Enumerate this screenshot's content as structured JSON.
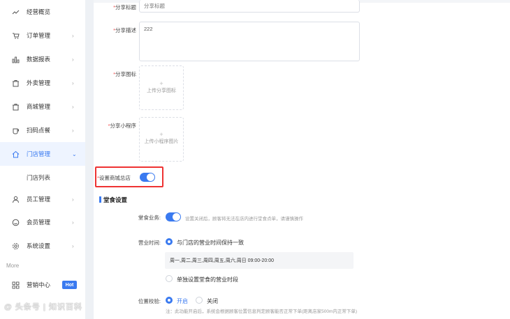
{
  "sidebar": {
    "items": [
      {
        "label": "经营概览",
        "icon": "trend-icon",
        "chev": ""
      },
      {
        "label": "订单管理",
        "icon": "cart-icon",
        "chev": "›"
      },
      {
        "label": "数据报表",
        "icon": "bar-chart-icon",
        "chev": "›"
      },
      {
        "label": "外卖管理",
        "icon": "takeout-icon",
        "chev": "›"
      },
      {
        "label": "商城管理",
        "icon": "shop-icon",
        "chev": "›"
      },
      {
        "label": "扫码点餐",
        "icon": "cup-icon",
        "chev": "›"
      },
      {
        "label": "门店管理",
        "icon": "home-icon",
        "chev": "⌄"
      },
      {
        "label": "员工管理",
        "icon": "user-icon",
        "chev": "›"
      },
      {
        "label": "会员管理",
        "icon": "smile-icon",
        "chev": "›"
      },
      {
        "label": "系统设置",
        "icon": "gear-icon",
        "chev": "›"
      }
    ],
    "sub_item": "门店列表",
    "more_label": "More",
    "marketing": {
      "label": "营销中心",
      "badge": "Hot",
      "icon": "grid-icon"
    }
  },
  "form": {
    "share_title": {
      "label": "分享标题",
      "placeholder": "分享标题"
    },
    "share_desc": {
      "label": "分享描述",
      "value": "222"
    },
    "share_icon": {
      "label": "分享图标",
      "upload_plus": "+",
      "upload_text": "上传分享图标"
    },
    "share_mini": {
      "label": "分享小程序",
      "upload_plus": "+",
      "upload_text": "上传小程序图片"
    },
    "mall_hq": {
      "label": "设置商城总店",
      "on": true
    },
    "required_mark": "*"
  },
  "dine_in": {
    "title": "堂食设置",
    "business": {
      "label": "堂食业务:",
      "hint": "设置关闭后，顾客将无法在店内进行堂食点单，请谨慎操作",
      "on": true
    },
    "hours": {
      "label": "营业时间:",
      "option_same": "与门店的营业时间保持一致",
      "schedule": "周一,周二,周三,周四,周五,周六,周日 09:00-20:00",
      "option_separate": "单独设置堂食的营业时段"
    },
    "location": {
      "label": "位置校验:",
      "on_label": "开启",
      "off_label": "关闭",
      "note": "注：此功能开启后，系统会根据顾客位置信息判定顾客能否正常下单(距离店家500m内正常下单)"
    }
  },
  "watermark": "@ 头条号 | 知识百科"
}
